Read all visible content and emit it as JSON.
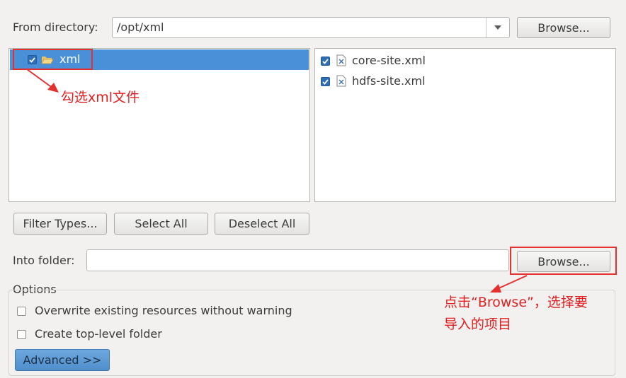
{
  "from_directory": {
    "label": "From directory:",
    "value": "/opt/xml",
    "browse_label": "Browse..."
  },
  "folders": [
    {
      "name": "xml",
      "checked": true,
      "selected": true
    }
  ],
  "files": [
    {
      "name": "core-site.xml",
      "checked": true
    },
    {
      "name": "hdfs-site.xml",
      "checked": true
    }
  ],
  "buttons": {
    "filter_types": "Filter Types...",
    "select_all": "Select All",
    "deselect_all": "Deselect All"
  },
  "into_folder": {
    "label": "Into folder:",
    "value": "",
    "browse_label": "Browse..."
  },
  "options": {
    "title": "Options",
    "overwrite": {
      "label": "Overwrite existing resources without warning",
      "checked": false
    },
    "create_top_level": {
      "label": "Create top-level folder",
      "checked": false
    },
    "advanced_label": "Advanced >>"
  },
  "annotations": {
    "check_xml": "勾选xml文件",
    "browse_line1": "点击“Browse”，选择要",
    "browse_line2": "导入的项目"
  },
  "colors": {
    "selection": "#4a90d9",
    "checkbox": "#2f6fb6",
    "annotation": "#e02020",
    "advanced_button": "#5b9bd5"
  }
}
